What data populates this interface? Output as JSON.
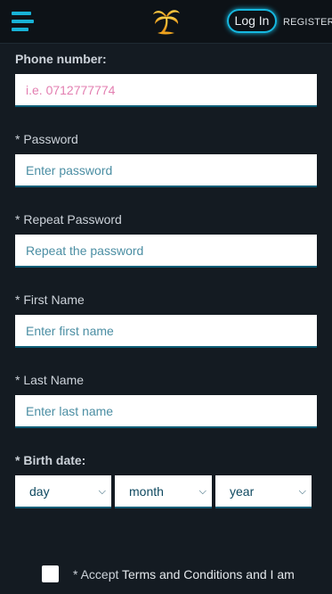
{
  "header": {
    "login_label": "Log In",
    "register_label": "REGISTER"
  },
  "form": {
    "phone": {
      "label": "Phone number:",
      "placeholder": "i.e. 0712777774"
    },
    "password": {
      "label": "* Password",
      "placeholder": "Enter password"
    },
    "repeat_password": {
      "label": "* Repeat Password",
      "placeholder": "Repeat the password"
    },
    "first_name": {
      "label": "* First Name",
      "placeholder": "Enter first name"
    },
    "last_name": {
      "label": "* Last Name",
      "placeholder": "Enter last name"
    },
    "birth_date": {
      "label": "* Birth date:",
      "day": "day",
      "month": "month",
      "year": "year"
    },
    "accept": {
      "prefix": "* Accept ",
      "link": "Terms and Conditions and I am"
    }
  },
  "colors": {
    "accent": "#16b8e0",
    "background": "#141b22",
    "placeholder": "#4b8ea3",
    "phone_placeholder": "#e37fb1"
  },
  "icons": [
    "hamburger-menu-icon",
    "palm-tree-logo-icon",
    "chevron-down-icon"
  ]
}
